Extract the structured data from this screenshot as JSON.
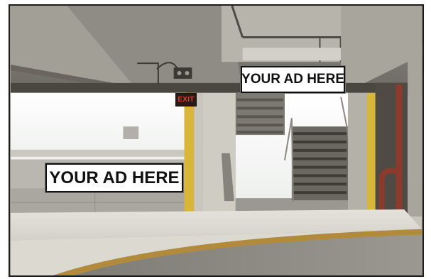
{
  "ad_top": {
    "label": "YOUR AD HERE"
  },
  "ad_left": {
    "label": "YOUR AD HERE"
  },
  "exit_sign": {
    "label": "EXIT"
  },
  "colors": {
    "concrete": "#9a9890",
    "ceiling_shadow": "#4a4640",
    "daylight": "#f4f6f4",
    "yellow_column": "#d8b63a",
    "curb": "#b28a3c",
    "pipe_red": "#8a3b2c",
    "exit_red": "#d8423a"
  }
}
